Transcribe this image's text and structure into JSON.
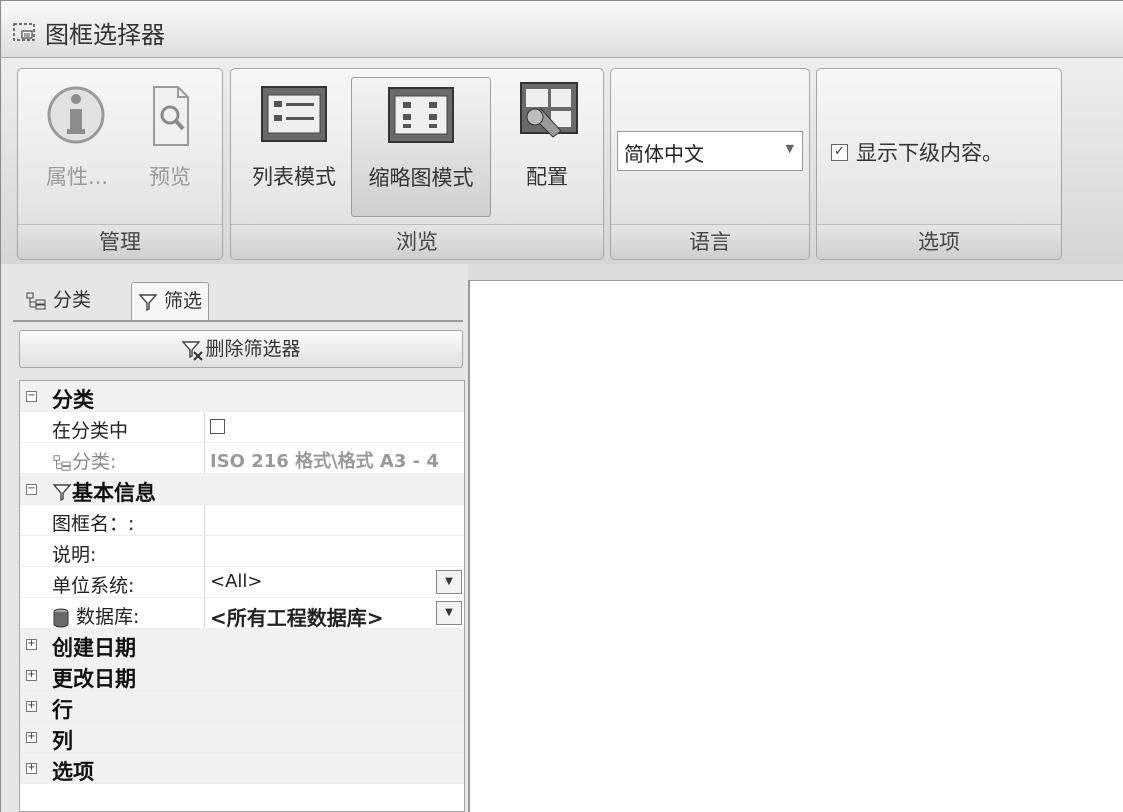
{
  "window": {
    "title": "图框选择器",
    "icon": "frame-selector-icon"
  },
  "ribbon": {
    "groups": [
      {
        "label": "管理",
        "buttons": [
          {
            "label": "属性...",
            "icon": "info-icon",
            "enabled": false
          },
          {
            "label": "预览",
            "icon": "preview-icon",
            "enabled": false
          }
        ]
      },
      {
        "label": "浏览",
        "buttons": [
          {
            "label": "列表模式",
            "icon": "list-mode-icon"
          },
          {
            "label": "缩略图模式",
            "icon": "thumbnail-mode-icon",
            "active": true
          },
          {
            "label": "配置",
            "icon": "config-icon"
          }
        ]
      },
      {
        "label": "语言",
        "select": {
          "value": "简体中文"
        }
      },
      {
        "label": "选项",
        "checkbox": {
          "label": "显示下级内容。",
          "checked": true
        }
      }
    ]
  },
  "left_panel": {
    "tabs": [
      {
        "label": "分类",
        "icon": "tree-icon"
      },
      {
        "label": "筛选",
        "icon": "filter-icon",
        "active": true
      }
    ],
    "delete_filter_label": "删除筛选器",
    "grid": {
      "category_section": {
        "label": "分类",
        "expanded": true,
        "in_category": {
          "label": "在分类中",
          "checked": false
        },
        "category": {
          "label": "分类:",
          "value": "ISO 216 格式\\格式 A3 - 4"
        }
      },
      "basic_section": {
        "label": "基本信息",
        "expanded": true,
        "frame_name": {
          "label": "图框名：:",
          "value": ""
        },
        "description": {
          "label": "说明:",
          "value": ""
        },
        "unit_system": {
          "label": "单位系统:",
          "value": "<All>"
        },
        "database": {
          "label": "数据库:",
          "value": "<所有工程数据库>"
        }
      },
      "collapsed_sections": [
        "创建日期",
        "更改日期",
        "行",
        "列",
        "选项"
      ]
    }
  }
}
